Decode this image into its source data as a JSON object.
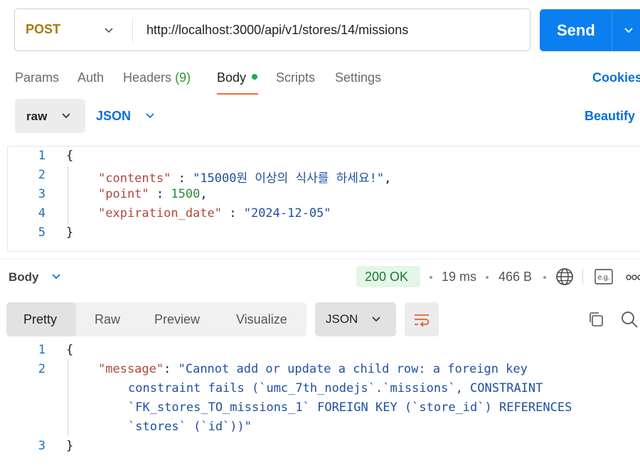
{
  "request": {
    "method": "POST",
    "url": "http://localhost:3000/api/v1/stores/14/missions",
    "send_label": "Send"
  },
  "tabs": {
    "params": "Params",
    "auth": "Auth",
    "headers": "Headers",
    "headers_count": "(9)",
    "body": "Body",
    "scripts": "Scripts",
    "settings": "Settings",
    "cookies": "Cookies"
  },
  "body_options": {
    "mode": "raw",
    "format": "JSON",
    "beautify": "Beautify"
  },
  "request_body": {
    "line_numbers": [
      "1",
      "2",
      "3",
      "4",
      "5"
    ],
    "open_brace": "{",
    "close_brace": "}",
    "k1": "\"contents\"",
    "v1": "\"15000원 이상의 식사를 하세요!\"",
    "k2": "\"point\"",
    "v2": "1500",
    "k3": "\"expiration_date\"",
    "v3": "\"2024-12-05\"",
    "sep": " : ",
    "comma": ","
  },
  "response": {
    "label": "Body",
    "status": "200 OK",
    "time": "19 ms",
    "size": "466 B",
    "eg_label": "e.g.",
    "view_tabs": [
      "Pretty",
      "Raw",
      "Preview",
      "Visualize"
    ],
    "format": "JSON",
    "line_numbers": [
      "1",
      "2",
      "3"
    ],
    "open_brace": "{",
    "close_brace": "}",
    "key": "\"message\"",
    "colon": ": ",
    "value_lines": [
      "\"Cannot add or update a child row: a foreign key",
      "constraint fails (`umc_7th_nodejs`.`missions`, CONSTRAINT",
      "`FK_stores_TO_missions_1` FOREIGN KEY (`store_id`) REFERENCES",
      "`stores` (`id`))\""
    ]
  },
  "colors": {
    "accent": "#0b7ff0",
    "method": "#a97b00",
    "status_ok": "#187a36",
    "tab_underline": "#f26b3a"
  },
  "icons": [
    "chevron-down-icon",
    "globe-icon",
    "example-icon",
    "more-icon",
    "wrap-icon",
    "copy-icon",
    "search-icon"
  ]
}
